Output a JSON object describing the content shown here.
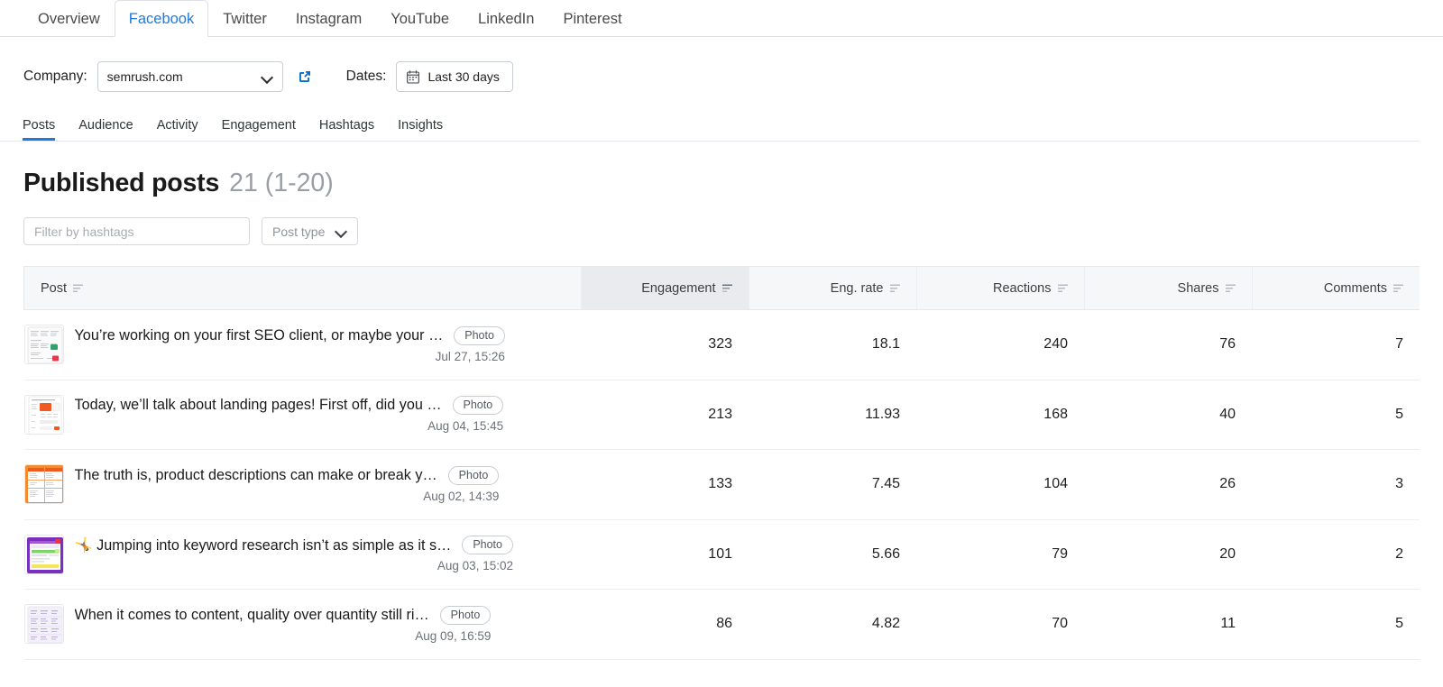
{
  "network_tabs": [
    {
      "label": "Overview",
      "active": false
    },
    {
      "label": "Facebook",
      "active": true
    },
    {
      "label": "Twitter",
      "active": false
    },
    {
      "label": "Instagram",
      "active": false
    },
    {
      "label": "YouTube",
      "active": false
    },
    {
      "label": "LinkedIn",
      "active": false
    },
    {
      "label": "Pinterest",
      "active": false
    }
  ],
  "filters": {
    "company_label": "Company:",
    "company_value": "semrush.com",
    "external_link_icon": "external-link-icon",
    "dates_label": "Dates:",
    "dates_value": "Last 30 days",
    "calendar_icon": "calendar-icon"
  },
  "sub_tabs": [
    {
      "label": "Posts",
      "active": true
    },
    {
      "label": "Audience",
      "active": false
    },
    {
      "label": "Activity",
      "active": false
    },
    {
      "label": "Engagement",
      "active": false
    },
    {
      "label": "Hashtags",
      "active": false
    },
    {
      "label": "Insights",
      "active": false
    }
  ],
  "page": {
    "title": "Published posts",
    "count": "21 (1-20)"
  },
  "controls": {
    "hashtag_placeholder": "Filter by hashtags",
    "hashtag_value": "",
    "post_type_label": "Post type"
  },
  "table": {
    "columns": [
      {
        "key": "post",
        "label": "Post",
        "sorted": false
      },
      {
        "key": "engagement",
        "label": "Engagement",
        "sorted": true
      },
      {
        "key": "eng_rate",
        "label": "Eng. rate",
        "sorted": false
      },
      {
        "key": "reactions",
        "label": "Reactions",
        "sorted": false
      },
      {
        "key": "shares",
        "label": "Shares",
        "sorted": false
      },
      {
        "key": "comments",
        "label": "Comments",
        "sorted": false
      }
    ],
    "rows": [
      {
        "title": "You’re working on your first SEO client, or maybe your …",
        "badge": "Photo",
        "date": "Jul 27, 15:26",
        "engagement": "323",
        "eng_rate": "18.1",
        "reactions": "240",
        "shares": "76",
        "comments": "7"
      },
      {
        "title": "Today, we’ll talk about landing pages! First off, did you …",
        "badge": "Photo",
        "date": "Aug 04, 15:45",
        "engagement": "213",
        "eng_rate": "11.93",
        "reactions": "168",
        "shares": "40",
        "comments": "5"
      },
      {
        "title": "The truth is, product descriptions can make or break y…",
        "badge": "Photo",
        "date": "Aug 02, 14:39",
        "engagement": "133",
        "eng_rate": "7.45",
        "reactions": "104",
        "shares": "26",
        "comments": "3"
      },
      {
        "title": "🤸 Jumping into keyword research isn’t as simple as it s…",
        "badge": "Photo",
        "date": "Aug 03, 15:02",
        "engagement": "101",
        "eng_rate": "5.66",
        "reactions": "79",
        "shares": "20",
        "comments": "2"
      },
      {
        "title": "When it comes to content, quality over quantity still ri…",
        "badge": "Photo",
        "date": "Aug 09, 16:59",
        "engagement": "86",
        "eng_rate": "4.82",
        "reactions": "70",
        "shares": "11",
        "comments": "5"
      }
    ]
  },
  "colors": {
    "accent": "#1f7ae0",
    "header_bg": "#f6f7f8",
    "sorted_header_bg": "#e9ebee",
    "border": "#e6e9ec",
    "muted_text": "#6c7179"
  }
}
